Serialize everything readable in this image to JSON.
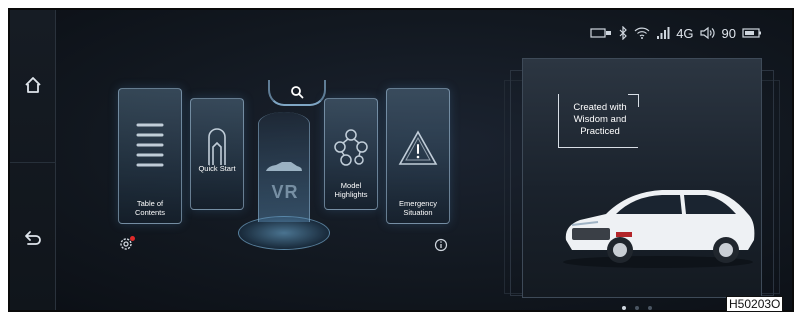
{
  "status": {
    "network": "4G",
    "volume": "90"
  },
  "sidebar": {
    "home_icon": "home-icon",
    "back_icon": "back-arrow-icon"
  },
  "menu": {
    "cards": [
      {
        "label_line1": "Table of",
        "label_line2": "Contents",
        "icon": "list-icon"
      },
      {
        "label_line1": "Quick Start",
        "label_line2": "",
        "icon": "seat-icon"
      },
      {
        "label_line1": "Model",
        "label_line2": "Highlights",
        "icon": "molecule-icon"
      },
      {
        "label_line1": "Emergency",
        "label_line2": "Situation",
        "icon": "warning-icon"
      }
    ],
    "vr_label": "VR"
  },
  "showcase": {
    "slogan_line1": "Created with",
    "slogan_line2": "Wisdom and",
    "slogan_line3": "Practiced"
  },
  "pager": {
    "count": 3,
    "active": 1
  },
  "figure_code": "H50203O",
  "colors": {
    "accent": "#7fa6c4",
    "notify": "#e02a2a"
  }
}
